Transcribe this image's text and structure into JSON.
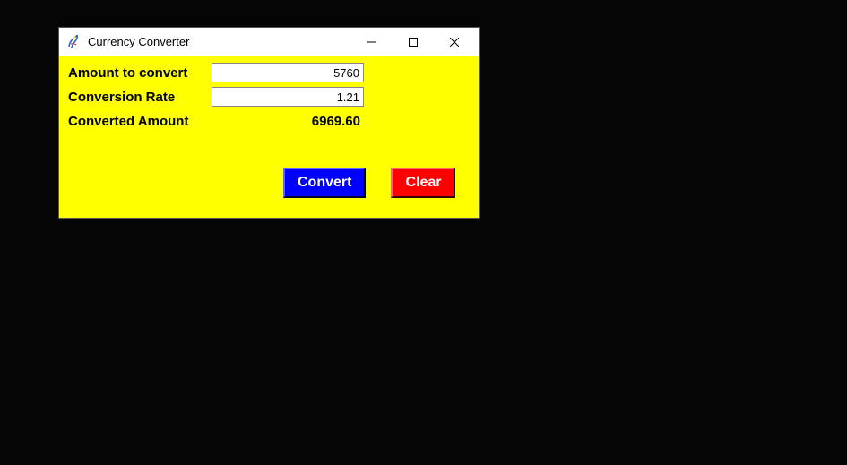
{
  "window": {
    "title": "Currency Converter"
  },
  "form": {
    "amount_label": "Amount to convert",
    "amount_value": "5760",
    "rate_label": "Conversion Rate",
    "rate_value": "1.21",
    "result_label": "Converted Amount",
    "result_value": "6969.60"
  },
  "buttons": {
    "convert": "Convert",
    "clear": "Clear"
  }
}
